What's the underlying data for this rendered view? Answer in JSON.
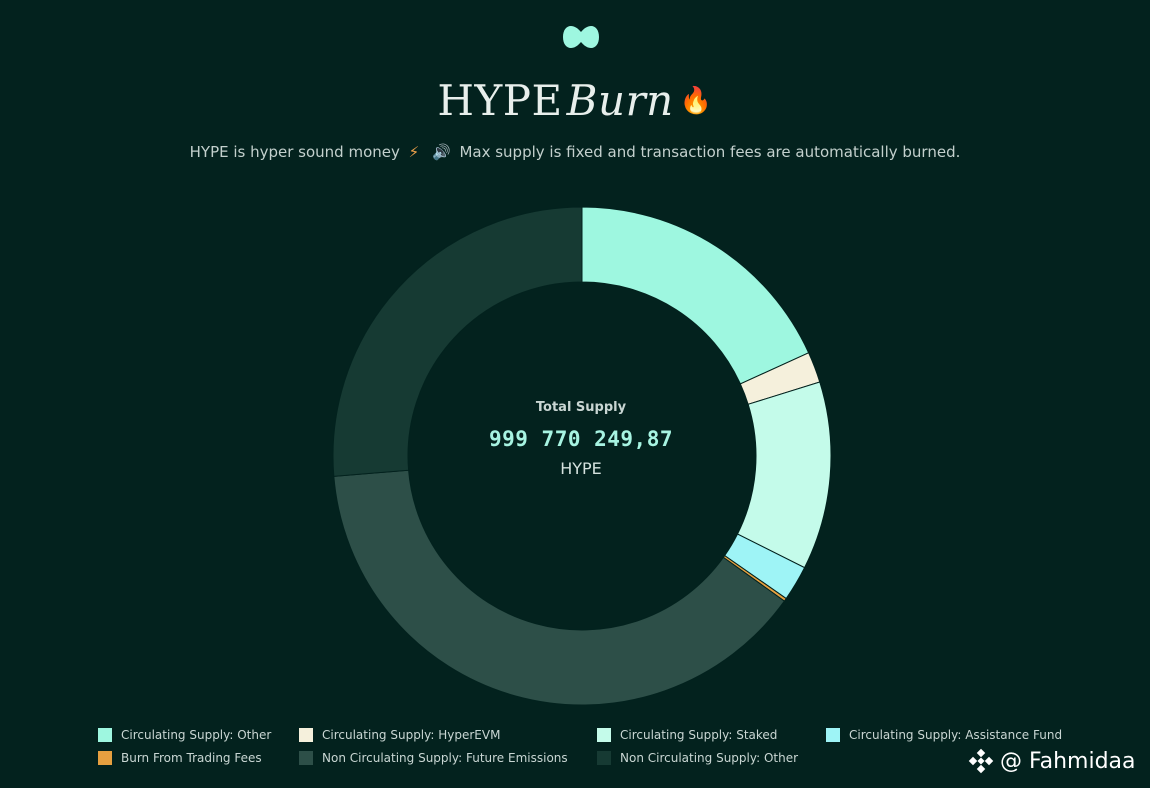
{
  "header": {
    "title_main": "HYPE",
    "title_italic": "Burn",
    "title_emoji": "🔥",
    "subtitle_part1": "HYPE is hyper sound money",
    "subtitle_bolt": "⚡",
    "subtitle_speaker": "🔊",
    "subtitle_part2": "Max supply is fixed and transaction fees are automatically burned."
  },
  "center": {
    "label": "Total Supply",
    "value": "999 770 249,87",
    "unit": "HYPE"
  },
  "watermark": {
    "handle": "@ Fahmidaa"
  },
  "chart_data": {
    "type": "pie",
    "style": "donut",
    "legend_placement": "bottom",
    "series": [
      {
        "name": "Circulating Supply: Other",
        "value": 18.2,
        "color": "#9ef7e0"
      },
      {
        "name": "Circulating Supply: HyperEVM",
        "value": 2.0,
        "color": "#f5f0dc"
      },
      {
        "name": "Circulating Supply: Staked",
        "value": 12.2,
        "color": "#c4fbea"
      },
      {
        "name": "Circulating Supply: Assistance Fund",
        "value": 2.3,
        "color": "#9ef4f6"
      },
      {
        "name": "Burn From Trading Fees",
        "value": 0.2,
        "color": "#e6a040"
      },
      {
        "name": "Non Circulating Supply: Future Emissions",
        "value": 38.8,
        "color": "#2d4f48"
      },
      {
        "name": "Non Circulating Supply: Other",
        "value": 26.3,
        "color": "#163a33"
      }
    ]
  }
}
